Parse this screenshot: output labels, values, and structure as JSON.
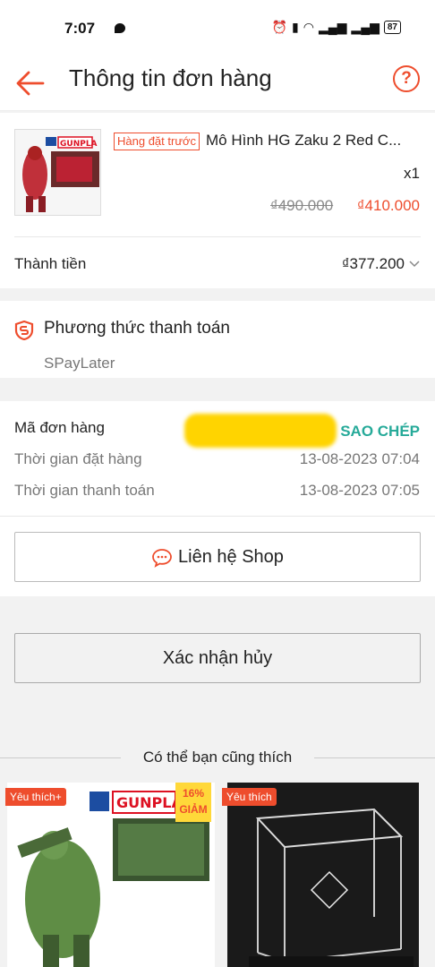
{
  "status_bar": {
    "time": "7:07",
    "battery": "87"
  },
  "header": {
    "title": "Thông tin đơn hàng",
    "help_icon": "?"
  },
  "product": {
    "tag": "Hàng đặt trước",
    "name": "Mô Hình HG Zaku 2 Red C...",
    "quantity": "x1",
    "original_price": "₫490.000",
    "price": "₫410.000"
  },
  "total": {
    "label": "Thành tiền",
    "value": "₫377.200"
  },
  "payment": {
    "title": "Phương thức thanh toán",
    "method": "SPayLater"
  },
  "order": {
    "id_label": "Mã đơn hàng",
    "copy_label": "SAO CHÉP",
    "order_time_label": "Thời gian đặt hàng",
    "order_time": "13-08-2023 07:04",
    "pay_time_label": "Thời gian thanh toán",
    "pay_time": "13-08-2023 07:05"
  },
  "contact_button": "Liên hệ Shop",
  "confirm_cancel_button": "Xác nhận hủy",
  "suggestions": {
    "title": "Có thể bạn cũng thích",
    "items": [
      {
        "badge": "Yêu thích+",
        "discount_pct": "16%",
        "discount_label": "GIẢM"
      },
      {
        "badge": "Yêu thích"
      }
    ]
  },
  "colors": {
    "accent": "#ee4d2d",
    "teal": "#26aa99"
  }
}
